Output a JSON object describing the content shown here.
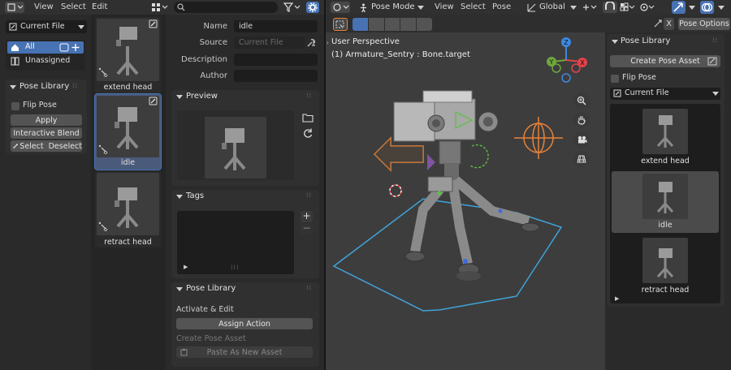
{
  "left_area": {
    "menus": [
      "View",
      "Select",
      "Edit"
    ],
    "search_placeholder": ""
  },
  "library_sidebar": {
    "library_select": "Current File",
    "catalog": [
      {
        "label": "All",
        "active": true
      },
      {
        "label": "Unassigned",
        "active": false
      }
    ],
    "pose_panel": {
      "title": "Pose Library",
      "flip_pose": "Flip Pose",
      "apply": "Apply",
      "interactive_blend": "Interactive Blend",
      "select": "Select",
      "deselect": "Deselect"
    }
  },
  "asset_grid": [
    {
      "label": "extend head",
      "selected": false
    },
    {
      "label": "idle",
      "selected": true
    },
    {
      "label": "retract head",
      "selected": false
    }
  ],
  "asset_details": {
    "fields": [
      {
        "label": "Name",
        "value": "idle",
        "placeholder": ""
      },
      {
        "label": "Source",
        "value": "",
        "placeholder": "Current File"
      },
      {
        "label": "Description",
        "value": "",
        "placeholder": ""
      },
      {
        "label": "Author",
        "value": "",
        "placeholder": ""
      }
    ],
    "preview_title": "Preview",
    "tags_title": "Tags",
    "pose_library": {
      "title": "Pose Library",
      "activate_edit": "Activate & Edit",
      "assign_action": "Assign Action",
      "create_pose_asset": "Create Pose Asset",
      "paste_as_new": "Paste As New Asset"
    }
  },
  "viewport": {
    "mode": "Pose Mode",
    "menus": [
      "View",
      "Select",
      "Pose"
    ],
    "orientation": "Global",
    "overlay_title": "User Perspective",
    "overlay_subtitle": "(1) Armature_Sentry : Bone.target",
    "close_label": "X",
    "pose_options": "Pose Options",
    "gizmo_axes": [
      "Z",
      "Y",
      "X"
    ]
  },
  "n_panel": {
    "title": "Pose Library",
    "create_pose_asset": "Create Pose Asset",
    "flip_pose": "Flip Pose",
    "library_select": "Current File",
    "assets": [
      {
        "label": "extend head",
        "selected": false
      },
      {
        "label": "idle",
        "selected": true
      },
      {
        "label": "retract head",
        "selected": false
      }
    ]
  },
  "colors": {
    "accent_blue": "#4772b3",
    "selected_bg": "#4a5a7a",
    "axis_x": "#e0434b",
    "axis_y": "#6fa63c",
    "axis_z": "#3d8ae0",
    "armature_orange": "#e8833a",
    "hull_blue": "#3fa3d8"
  }
}
